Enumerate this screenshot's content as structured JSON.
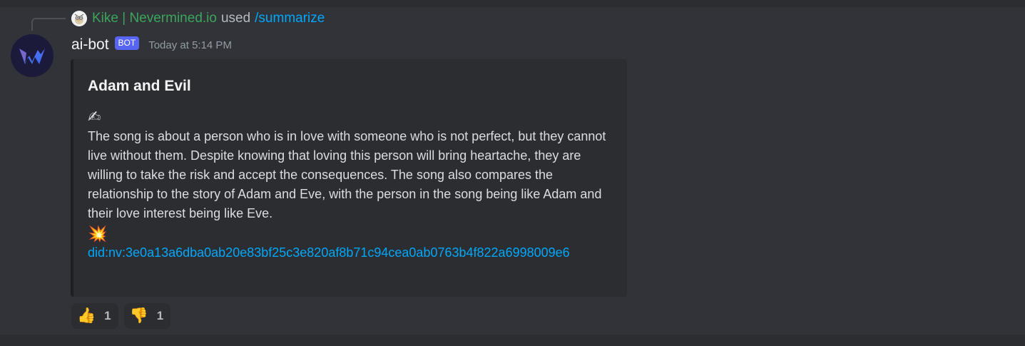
{
  "reply": {
    "avatar_icon": "bird-avatar-icon",
    "username": "Kike | Nevermined.io",
    "used_text": "used",
    "command": "/summarize"
  },
  "message": {
    "avatar_icon": "w-logo-avatar-icon",
    "username": "ai-bot",
    "bot_tag": "BOT",
    "timestamp": "Today at 5:14 PM"
  },
  "embed": {
    "title": "Adam and Evil",
    "emoji_top": "✍",
    "body": "The song is about a person who is in love with someone who is not perfect, but they cannot live without them. Despite knowing that loving this person will bring heartache, they are willing to take the risk and accept the consequences. The song also compares the relationship to the story of Adam and Eve, with the person in the song being like Adam and their love interest being like Eve.",
    "emoji_bottom": "💥",
    "link": "did:nv:3e0a13a6dba0ab20e83bf25c3e820af8b71c94cea0ab0763b4f822a6998009e6"
  },
  "reactions": [
    {
      "emoji": "👍",
      "count": "1",
      "icon": "thumbs-up-icon"
    },
    {
      "emoji": "👎",
      "count": "1",
      "icon": "thumbs-down-icon"
    }
  ],
  "colors": {
    "background": "#313338",
    "embed_background": "#2b2d31",
    "username_green": "#3ba55c",
    "link_blue": "#00a8fc",
    "bot_tag": "#5865f2"
  }
}
